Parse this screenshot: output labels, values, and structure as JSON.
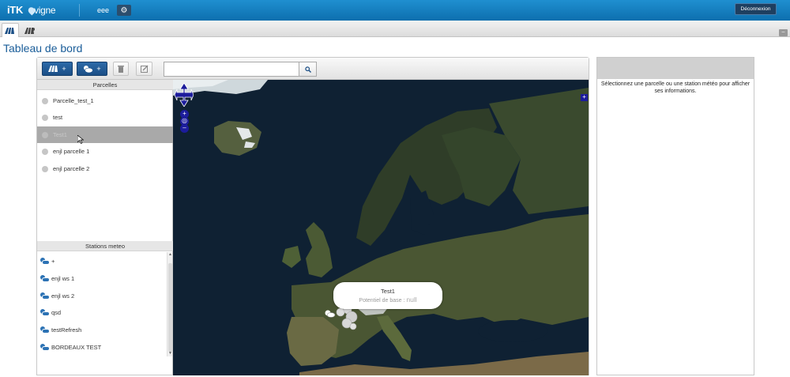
{
  "header": {
    "brand": "iTK",
    "brand_product": "vigne",
    "username": "eee",
    "settings_icon": "gear-icon",
    "logout_label": "Déconnexion"
  },
  "tabs": [
    {
      "icon": "parcels-tab-icon",
      "active": true
    },
    {
      "icon": "vine-rows-tab-icon",
      "active": false
    }
  ],
  "page": {
    "title": "Tableau de bord"
  },
  "toolbar": {
    "add_parcel_plus": "+",
    "add_station_plus": "+",
    "search": {
      "value": "",
      "placeholder": ""
    }
  },
  "parcels": {
    "header": "Parcelles",
    "items": [
      {
        "label": "Parcelle_test_1",
        "selected": false
      },
      {
        "label": "test",
        "selected": false
      },
      {
        "label": "Test1",
        "selected": true
      },
      {
        "label": "enjl parcelle 1",
        "selected": false
      },
      {
        "label": "enjl parcelle 2",
        "selected": false
      }
    ]
  },
  "stations": {
    "header": "Stations meteo",
    "items": [
      {
        "label": "+"
      },
      {
        "label": "enjl ws 1"
      },
      {
        "label": "enjl ws 2"
      },
      {
        "label": "qsd"
      },
      {
        "label": "testRefresh"
      },
      {
        "label": "BORDEAUX TEST"
      }
    ]
  },
  "map": {
    "popup_title": "Test1",
    "popup_label": "Potentiel de base :",
    "popup_value": "null"
  },
  "info_panel": {
    "message": "Sélectionnez une parcelle ou une station météo pour afficher ses informations."
  },
  "colors": {
    "header_bar": "#1a84c6",
    "accent_button": "#1b4f86",
    "selected_row": "#a9a9a9",
    "map_controls": "#1c1c9c"
  }
}
